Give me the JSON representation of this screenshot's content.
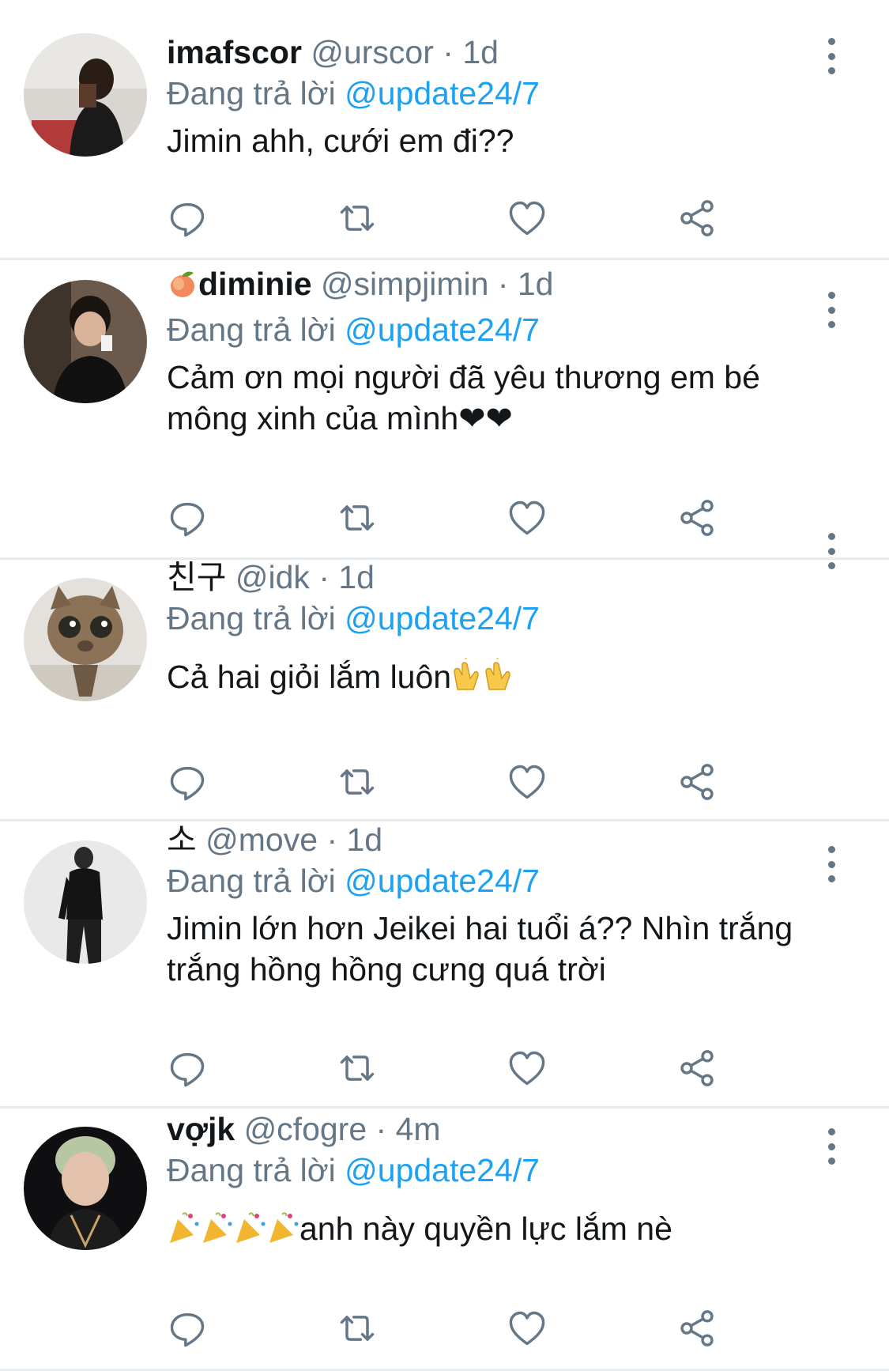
{
  "colors": {
    "name": "#14171a",
    "secondary": "#657786",
    "link": "#1da1f2",
    "divider": "#e6ecf0",
    "icon": "#657786"
  },
  "tweets": [
    {
      "name": "imafscor",
      "handle": "@urscor",
      "separator": "·",
      "time": "1d",
      "reply_prefix": "Đang trả lời",
      "reply_to": "@update24/7",
      "text": "Jimin ahh, cưới em đi??",
      "name_emoji": "",
      "text_emoji": "",
      "text_emoji_prefix": ""
    },
    {
      "name": "diminie",
      "name_emoji": "peach-emoji",
      "handle": "@simpjimin",
      "separator": "·",
      "time": "1d",
      "reply_prefix": "Đang trả lời",
      "reply_to": "@update24/7",
      "text": "Cảm ơn mọi người đã yêu thương em bé mông xinh của mình❤︎❤︎",
      "text_emoji": "",
      "text_emoji_prefix": ""
    },
    {
      "name": "친구",
      "name_emoji": "",
      "handle": "@idk",
      "separator": "·",
      "time": "1d",
      "reply_prefix": "Đang trả lời",
      "reply_to": "@update24/7",
      "text": "Cả hai giỏi lắm luôn",
      "text_emoji": "clapping-hands-emoji x2",
      "text_emoji_prefix": ""
    },
    {
      "name": "소",
      "name_emoji": "",
      "handle": "@move",
      "separator": "·",
      "time": "1d",
      "reply_prefix": "Đang trả lời",
      "reply_to": "@update24/7",
      "text": "Jimin lớn hơn Jeikei hai tuổi á?? Nhìn trắng trắng hồng hồng cưng quá trời",
      "text_emoji": "",
      "text_emoji_prefix": ""
    },
    {
      "name": "vợjk",
      "name_emoji": "",
      "handle": "@cfogre",
      "separator": "·",
      "time": "4m",
      "reply_prefix": "Đang trả lời",
      "reply_to": "@update24/7",
      "text": "anh này quyền lực lắm nè",
      "text_emoji": "",
      "text_emoji_prefix": "party-popper-emoji x4"
    }
  ],
  "icons": {
    "more": "more-vertical-icon",
    "reply": "reply-bubble-icon",
    "retweet": "retweet-icon",
    "like": "heart-icon",
    "share": "share-icon"
  }
}
